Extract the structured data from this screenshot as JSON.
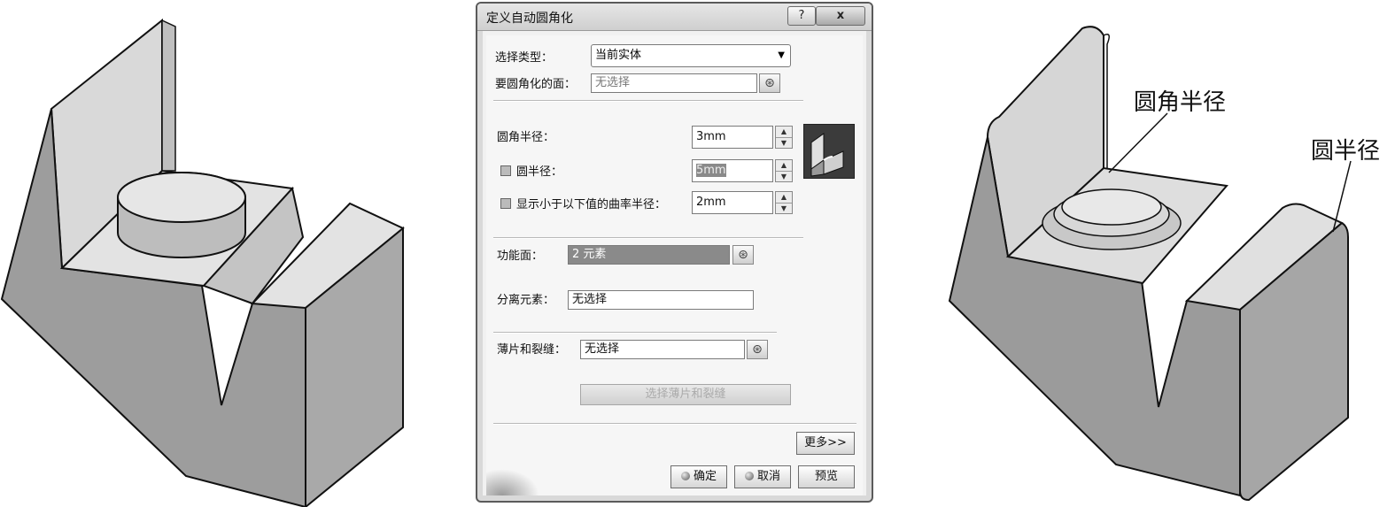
{
  "dialog": {
    "title": "定义自动圆角化",
    "help_label": "?",
    "close_label": "x",
    "selection_type": {
      "label": "选择类型：",
      "value": "当前实体"
    },
    "faces_to_fillet": {
      "label": "要圆角化的面：",
      "value": "无选择"
    },
    "fillet_radius": {
      "label": "圆角半径：",
      "value": "3mm"
    },
    "round_radius": {
      "label": "圆半径：",
      "value": "5mm"
    },
    "show_curvature": {
      "label": "显示小于以下值的曲率半径：",
      "value": "2mm"
    },
    "functional_faces": {
      "label": "功能面：",
      "value": "2 元素"
    },
    "separation_elements": {
      "label": "分离元素：",
      "value": "无选择"
    },
    "ribs_and_slots": {
      "label": "薄片和裂缝：",
      "value": "无选择"
    },
    "select_ribs_button": "选择薄片和裂缝",
    "more_button": "更多>>",
    "ok_button": "确定",
    "cancel_button": "取消",
    "preview_button": "预览"
  },
  "callouts": {
    "fillet_radius": "圆角半径",
    "round_radius": "圆半径"
  },
  "colors": {
    "model_face_light": "#e6e6e6",
    "model_face_mid": "#b4b4b4",
    "model_face_dark": "#8f8f8f",
    "dialog_bg": "#f1f1f1"
  }
}
